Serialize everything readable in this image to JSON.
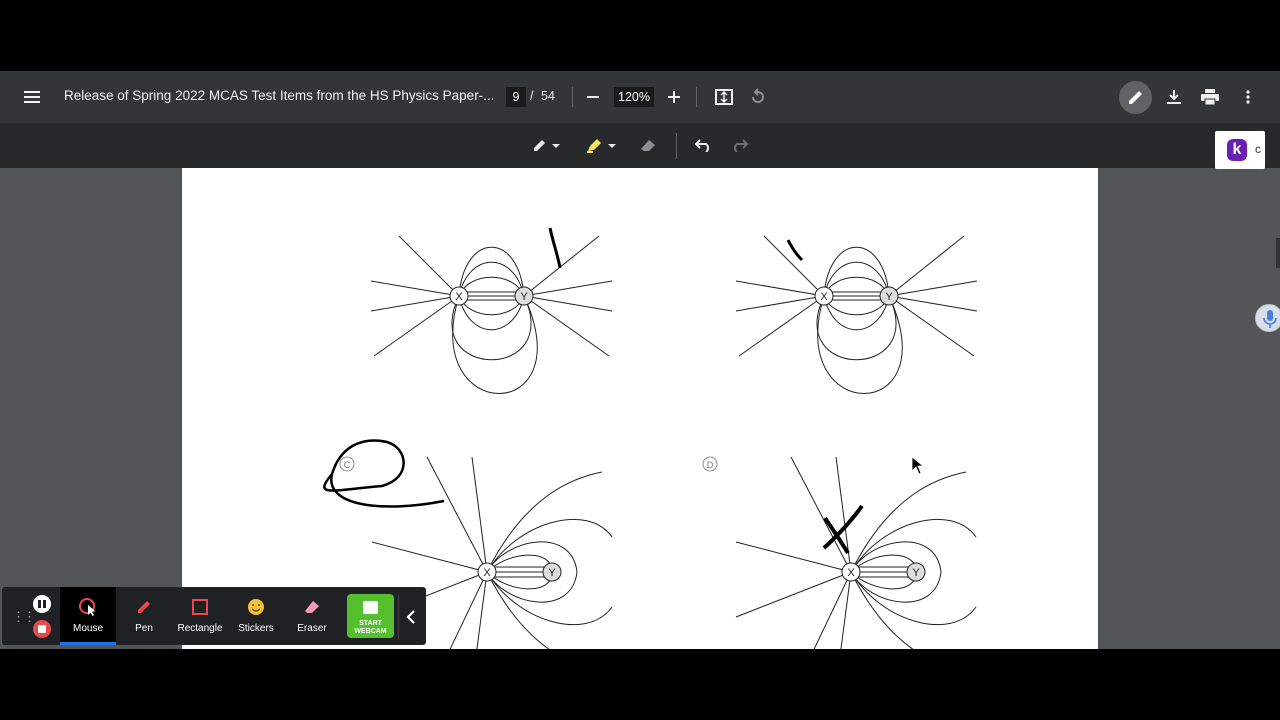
{
  "viewer": {
    "title": "Release of Spring 2022 MCAS Test Items from the HS Physics Paper-...",
    "current_page": "9",
    "page_separator": "/",
    "total_pages": "54",
    "zoom": "120%",
    "icons": [
      "menu-icon",
      "zoom-out-icon",
      "zoom-in-icon",
      "fit-page-icon",
      "rotate-icon",
      "draw-icon",
      "download-icon",
      "print-icon",
      "more-vert-icon"
    ]
  },
  "annotation_toolbar": {
    "icons": [
      "pen-icon",
      "highlighter-icon",
      "eraser-icon",
      "undo-icon",
      "redo-icon"
    ]
  },
  "extension": {
    "letter": "k",
    "partial_text": "c"
  },
  "diagram": {
    "option_c_label": "C",
    "option_d_label": "D",
    "charge_x": "X",
    "charge_y": "Y"
  },
  "recorder": {
    "tools": [
      {
        "label": "Mouse",
        "icon": "mouse-cursor-icon",
        "active": true
      },
      {
        "label": "Pen",
        "icon": "pen-icon"
      },
      {
        "label": "Rectangle",
        "icon": "rectangle-icon"
      },
      {
        "label": "Stickers",
        "icon": "sticker-icon"
      },
      {
        "label": "Eraser",
        "icon": "eraser-icon"
      }
    ],
    "webcam_line1": "START",
    "webcam_line2": "WEBCAM",
    "colors": {
      "webcam": "#55c02e",
      "stop": "#e84a4a",
      "active_underline": "#1a73e8"
    }
  }
}
